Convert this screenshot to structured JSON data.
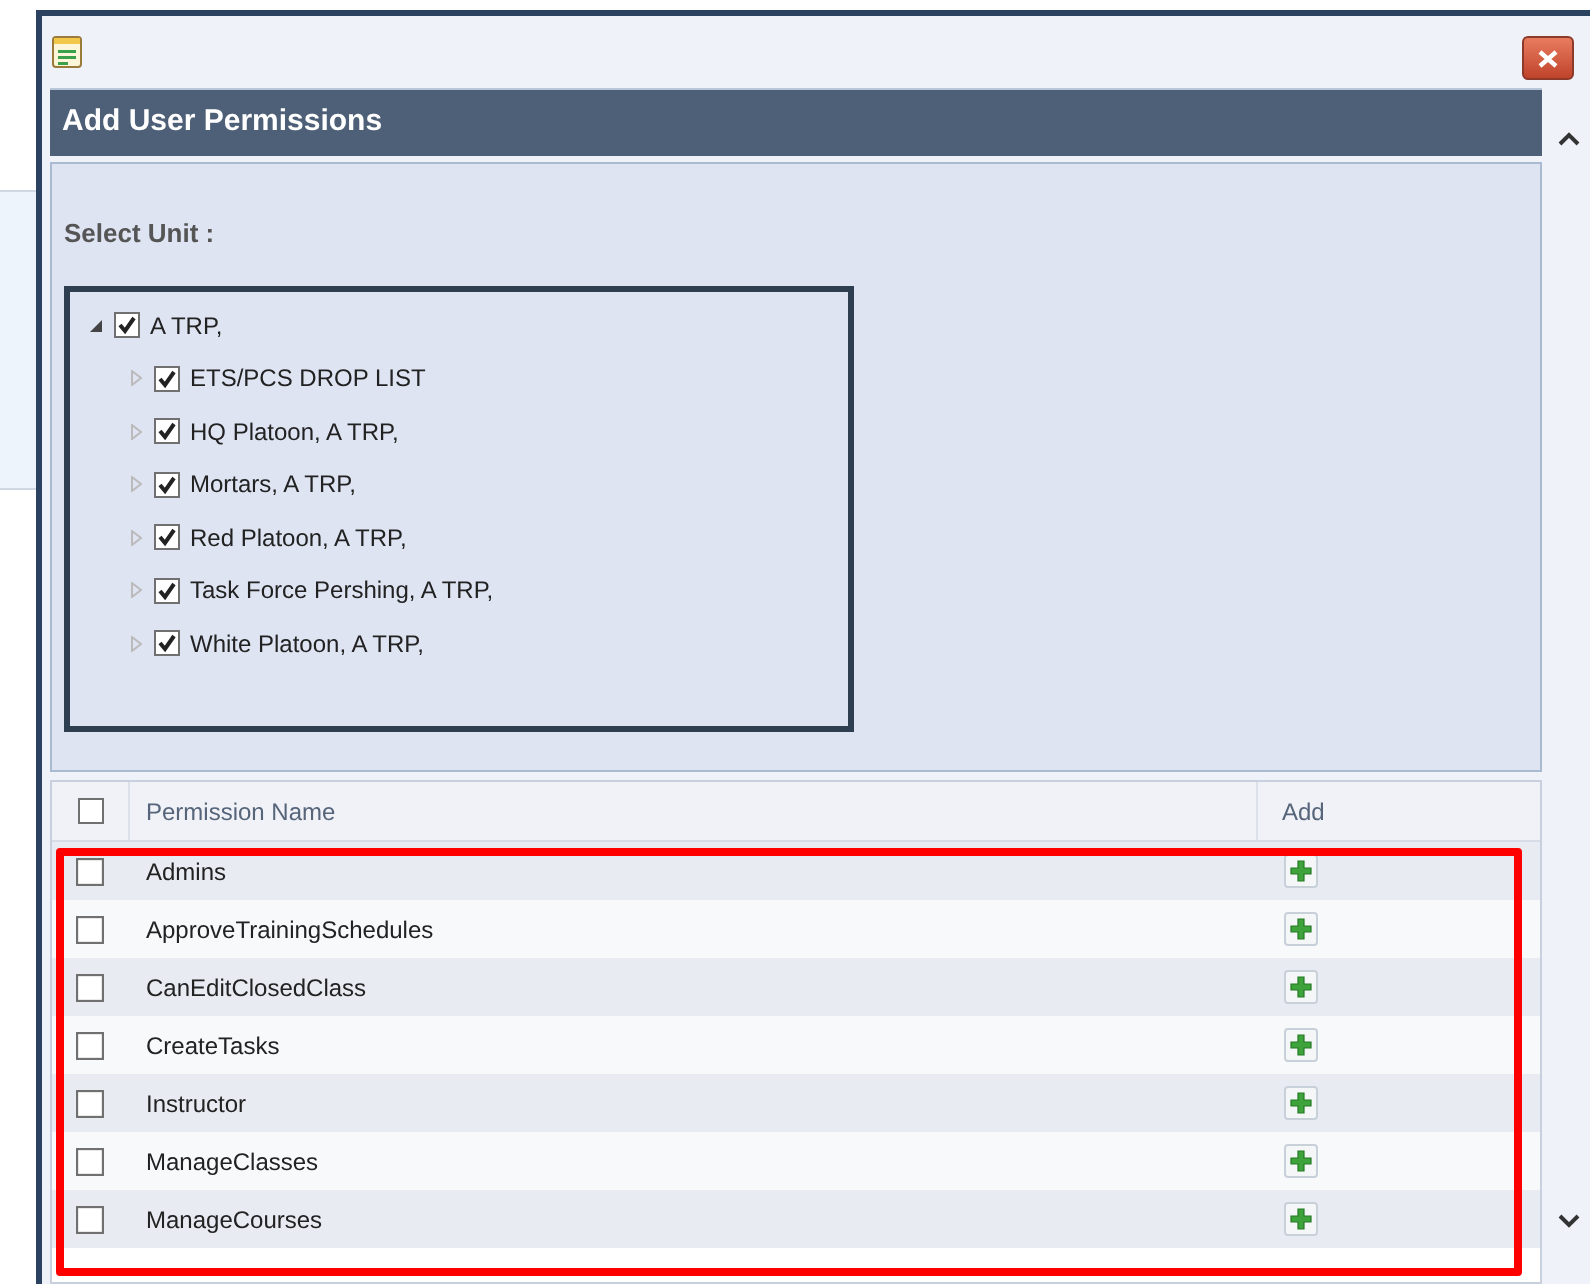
{
  "dialog": {
    "title": "Add User Permissions"
  },
  "unit_selector": {
    "label": "Select Unit :",
    "tree": [
      {
        "label": "A TRP,",
        "checked": true,
        "expanded": true,
        "children": [
          {
            "label": "ETS/PCS DROP LIST",
            "checked": true,
            "expanded": false
          },
          {
            "label": "HQ Platoon, A TRP,",
            "checked": true,
            "expanded": false
          },
          {
            "label": "Mortars, A TRP,",
            "checked": true,
            "expanded": false
          },
          {
            "label": "Red Platoon, A TRP,",
            "checked": true,
            "expanded": false
          },
          {
            "label": "Task Force Pershing, A TRP,",
            "checked": true,
            "expanded": false
          },
          {
            "label": "White Platoon, A TRP,",
            "checked": true,
            "expanded": false
          }
        ]
      }
    ]
  },
  "permissions_table": {
    "columns": [
      "Permission Name",
      "Add"
    ],
    "select_all_checked": false,
    "rows": [
      {
        "name": "Admins",
        "checked": false
      },
      {
        "name": "ApproveTrainingSchedules",
        "checked": false
      },
      {
        "name": "CanEditClosedClass",
        "checked": false
      },
      {
        "name": "CreateTasks",
        "checked": false
      },
      {
        "name": "Instructor",
        "checked": false
      },
      {
        "name": "ManageClasses",
        "checked": false
      },
      {
        "name": "ManageCourses",
        "checked": false
      }
    ]
  },
  "annotation": {
    "kind": "highlight-frame"
  }
}
